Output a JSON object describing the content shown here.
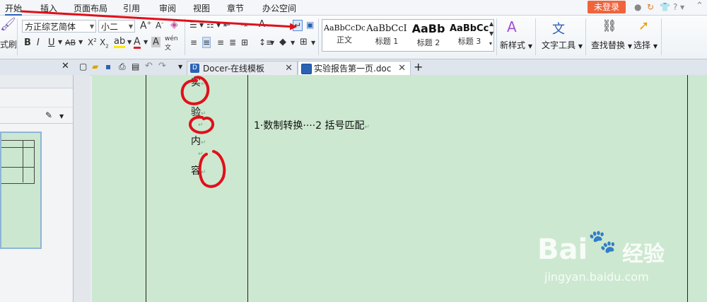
{
  "menu": {
    "items": [
      "开始",
      "插入",
      "页面布局",
      "引用",
      "审阅",
      "视图",
      "章节",
      "办公空间"
    ],
    "login": "未登录",
    "help": "?"
  },
  "ribbon": {
    "format_painter": "式刷",
    "font_name": "方正综艺简体",
    "font_size": "小二",
    "styles": [
      {
        "sample": "AaBbCcDc",
        "name": "正文"
      },
      {
        "sample": "AaBbCcI",
        "name": "标题 1"
      },
      {
        "sample": "AaBb",
        "name": "标题 2"
      },
      {
        "sample": "AaBbCcI",
        "name": "标题 3"
      }
    ],
    "new_style": "新样式",
    "text_tools": "文字工具",
    "find_replace": "查找替换",
    "select": "选择"
  },
  "tabs": [
    {
      "label": "Docer-在线模板",
      "icon": "docer-icon"
    },
    {
      "label": "实验报告第一页.doc",
      "icon": "wps-doc-icon"
    }
  ],
  "document": {
    "left_chars": [
      "实",
      "验",
      "内",
      "容"
    ],
    "content_line": "1·数制转换····2 括号匹配",
    "paragraph_mark": "↵"
  },
  "watermark": {
    "brand": "Bai",
    "brand2": "经验",
    "url": "jingyan.baidu.com"
  },
  "colors": {
    "accent": "#2a62b5",
    "login": "#f0643c",
    "page": "#cde8d0",
    "annotation": "#e0101a"
  }
}
